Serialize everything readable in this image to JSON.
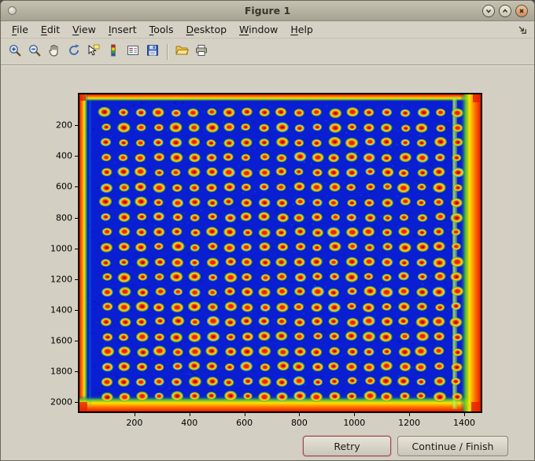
{
  "window": {
    "title": "Figure 1"
  },
  "titlebar": {
    "controls": [
      {
        "name": "minimize"
      },
      {
        "name": "maximize"
      },
      {
        "name": "close"
      }
    ]
  },
  "menu": {
    "items": [
      {
        "label": "File"
      },
      {
        "label": "Edit"
      },
      {
        "label": "View"
      },
      {
        "label": "Insert"
      },
      {
        "label": "Tools"
      },
      {
        "label": "Desktop"
      },
      {
        "label": "Window"
      },
      {
        "label": "Help"
      }
    ]
  },
  "toolbar": {
    "icons": [
      {
        "name": "zoom-in"
      },
      {
        "name": "zoom-out"
      },
      {
        "name": "pan"
      },
      {
        "name": "rotate-3d"
      },
      {
        "name": "data-cursor"
      },
      {
        "name": "insert-colorbar"
      },
      {
        "name": "insert-legend"
      },
      {
        "name": "save"
      },
      {
        "name": "open-folder",
        "group_start": true
      },
      {
        "name": "print"
      }
    ]
  },
  "plot": {
    "x_ticks": [
      200,
      400,
      600,
      800,
      1000,
      1200,
      1400
    ],
    "y_ticks": [
      200,
      400,
      600,
      800,
      1000,
      1200,
      1400,
      1600,
      1800,
      2000
    ],
    "x_range": [
      0,
      1460
    ],
    "y_range": [
      0,
      2060
    ],
    "image": {
      "background": "#0a1ed2",
      "edge_gradient": [
        "#e51a00",
        "#ff7a00",
        "#ffe400",
        "#50cd28"
      ],
      "stripe_color": "#8ce13c",
      "dot_colors": {
        "fringe": "#60c32a",
        "alt_fringe": "#32c8a0",
        "ring": "#ffd61c",
        "alt_ring": "#cfe32c",
        "mid": "#ff8010",
        "core": "#e22805",
        "dark_core": "#9a1200"
      },
      "grid": {
        "rows": 20,
        "cols": 21
      }
    }
  },
  "buttons": {
    "retry": "Retry",
    "continue_finish": "Continue / Finish"
  }
}
